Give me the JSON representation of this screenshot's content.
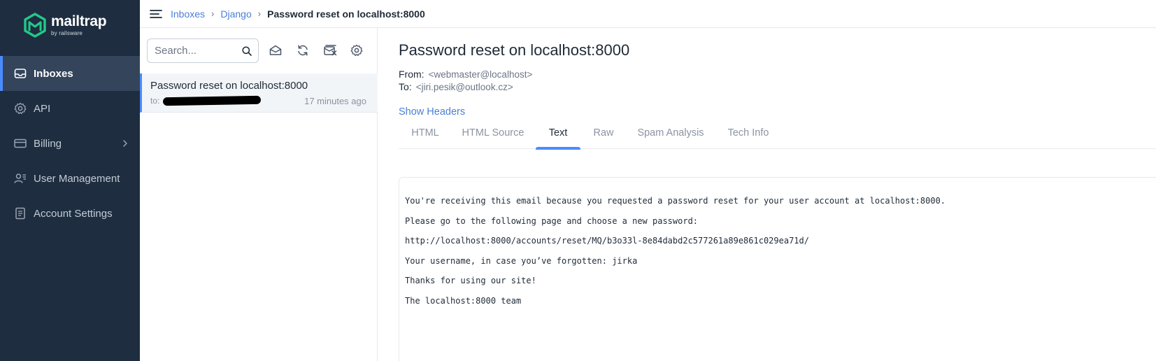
{
  "brand": {
    "name": "mailtrap",
    "sub": "by railsware",
    "accent": "#22c98a"
  },
  "sidebar": {
    "items": [
      {
        "label": "Inboxes",
        "icon": "inbox-icon",
        "active": true
      },
      {
        "label": "API",
        "icon": "gear-icon"
      },
      {
        "label": "Billing",
        "icon": "credit-card-icon",
        "has_chevron": true
      },
      {
        "label": "User Management",
        "icon": "users-icon"
      },
      {
        "label": "Account Settings",
        "icon": "document-icon"
      }
    ]
  },
  "breadcrumb": {
    "items": [
      "Inboxes",
      "Django"
    ],
    "current": "Password reset on localhost:8000",
    "separator": "›"
  },
  "list": {
    "search_placeholder": "Search...",
    "toolbar_icons": [
      "mark-read-icon",
      "refresh-icon",
      "clear-inbox-icon",
      "settings-icon"
    ],
    "messages": [
      {
        "subject": "Password reset on localhost:8000",
        "to_label": "to:",
        "time": "17 minutes ago"
      }
    ]
  },
  "message": {
    "subject": "Password reset on localhost:8000",
    "from_label": "From:",
    "from_value": "<webmaster@localhost>",
    "to_label": "To:",
    "to_value": "<jiri.pesik@outlook.cz>",
    "show_headers": "Show Headers",
    "tabs": [
      "HTML",
      "HTML Source",
      "Text",
      "Raw",
      "Spam Analysis",
      "Tech Info"
    ],
    "active_tab": "Text",
    "body_lines": [
      "You're receiving this email because you requested a password reset for your user account at localhost:8000.",
      "Please go to the following page and choose a new password:",
      "http://localhost:8000/accounts/reset/MQ/b3o33l-8e84dabd2c577261a89e861c029ea71d/",
      "Your username, in case you’ve forgotten: jirka",
      "Thanks for using our site!",
      "The localhost:8000 team"
    ]
  },
  "colors": {
    "sidebar_bg": "#1e2d40",
    "accent_blue": "#4a8cff",
    "link": "#4a7fd9"
  }
}
